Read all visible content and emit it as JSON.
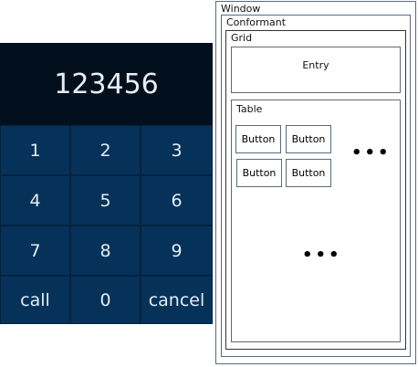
{
  "dialer": {
    "display": "123456",
    "keys": [
      "1",
      "2",
      "3",
      "4",
      "5",
      "6",
      "7",
      "8",
      "9",
      "call",
      "0",
      "cancel"
    ]
  },
  "diagram": {
    "window": "Window",
    "conformant": "Conformant",
    "grid": "Grid",
    "entry": "Entry",
    "table": "Table",
    "buttons": [
      "Button",
      "Button",
      "Button",
      "Button"
    ],
    "ellipsis": "•••"
  }
}
